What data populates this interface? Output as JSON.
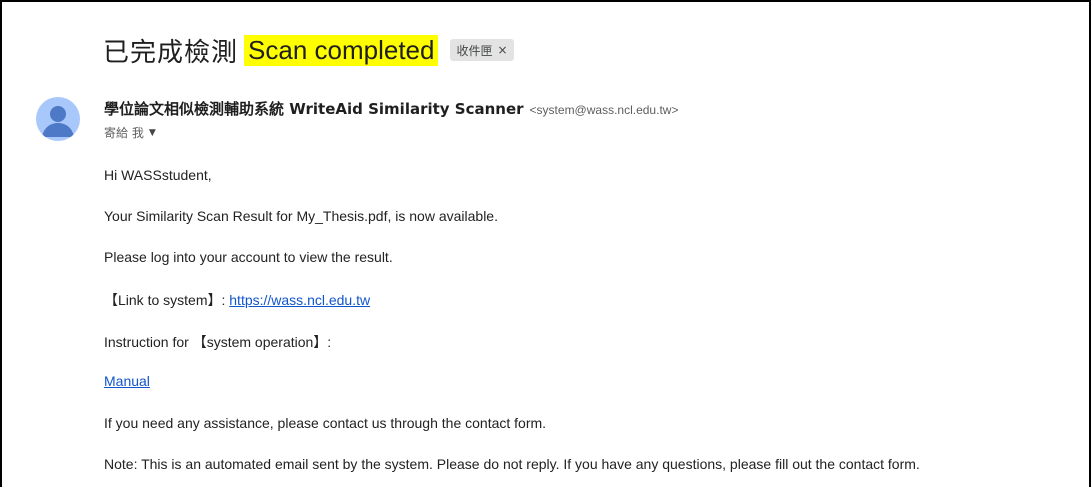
{
  "email": {
    "subject_zh": "已完成檢測",
    "subject_en": "Scan completed",
    "label": "收件匣",
    "label_close": "×",
    "sender_name": "學位論文相似檢測輔助系統 WriteAid Similarity Scanner",
    "sender_email": "<system@wass.ncl.edu.tw>",
    "to_text": "寄給 我",
    "to_caret": "▼",
    "lines": {
      "greeting": "Hi WASSstudent,",
      "result": "Your Similarity Scan Result for My_Thesis.pdf, is now available.",
      "login": "Please log into your account to view the result.",
      "link_prefix": "【Link to system】: ",
      "link_url": "https://wass.ncl.edu.tw",
      "instruction": "Instruction for 【system operation】:",
      "manual": "Manual",
      "assist": "If you need any assistance, please contact us through the contact form.",
      "note": "Note: This is an automated email sent by the system. Please do not reply. If you have any questions, please fill out the contact form."
    }
  },
  "colors": {
    "highlight": "#ffff00",
    "link": "#1155cc",
    "avatar_bg": "#a8c7fa",
    "avatar_fg": "#4d79c6"
  },
  "icons": {
    "avatar": "person-avatar-icon",
    "caret": "caret-down-icon",
    "label_close": "close-icon"
  }
}
